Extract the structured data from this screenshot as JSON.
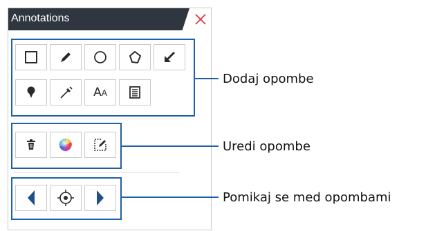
{
  "panel": {
    "title": "Annotations",
    "close_icon": "close-icon"
  },
  "groups": {
    "add": {
      "callout": "Dodaj opombe",
      "tools": [
        "rectangle-icon",
        "pencil-icon",
        "ellipse-icon",
        "polygon-icon",
        "arrow-icon",
        "pin-icon",
        "pen-tool-icon",
        "text-icon",
        "note-icon"
      ],
      "text_tool_glyph": "A",
      "text_tool_glyph_small": "A"
    },
    "edit": {
      "callout": "Uredi opombe",
      "tools": [
        "trash-icon",
        "color-wheel-icon",
        "edit-icon"
      ]
    },
    "navigate": {
      "callout": "Pomikaj se med opombami",
      "tools": [
        "previous-icon",
        "target-icon",
        "next-icon"
      ]
    }
  },
  "colors": {
    "header_bg": "#2f3640",
    "close_red": "#e0383e",
    "group_border": "#1f5fa8",
    "icon_dark": "#2b2b2b"
  }
}
